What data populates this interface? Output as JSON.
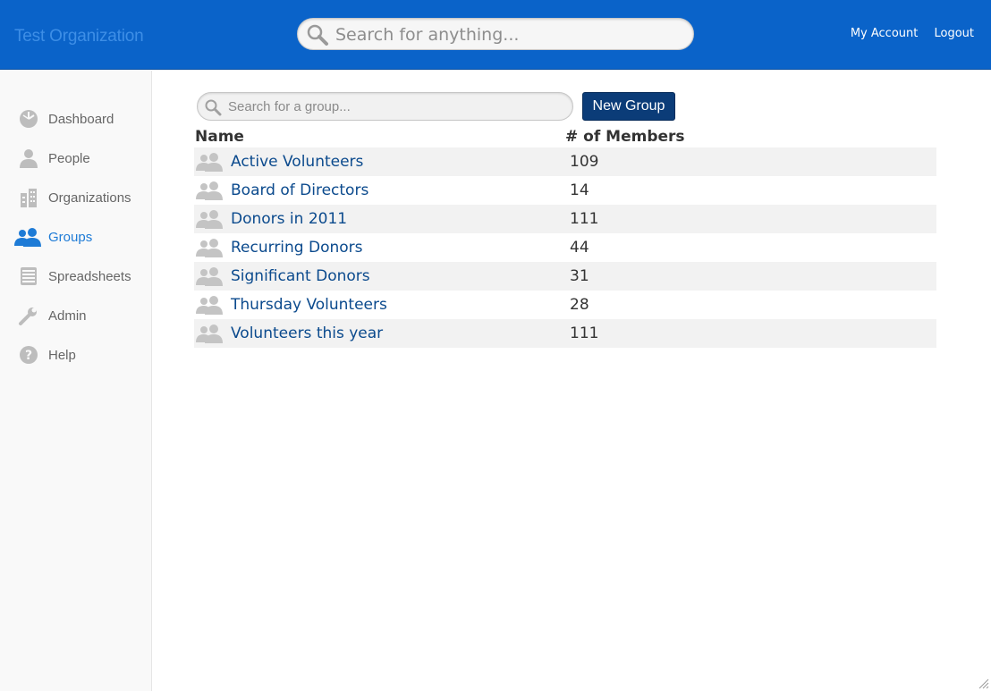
{
  "header": {
    "org_name": "Test Organization",
    "search_placeholder": "Search for anything...",
    "links": {
      "my_account": "My Account",
      "logout": "Logout"
    }
  },
  "sidebar": {
    "items": [
      {
        "label": "Dashboard",
        "icon": "dashboard-icon",
        "active": false
      },
      {
        "label": "People",
        "icon": "person-icon",
        "active": false
      },
      {
        "label": "Organizations",
        "icon": "building-icon",
        "active": false
      },
      {
        "label": "Groups",
        "icon": "group-icon",
        "active": true
      },
      {
        "label": "Spreadsheets",
        "icon": "spreadsheet-icon",
        "active": false
      },
      {
        "label": "Admin",
        "icon": "wrench-icon",
        "active": false
      },
      {
        "label": "Help",
        "icon": "help-icon",
        "active": false
      }
    ]
  },
  "main": {
    "group_search_placeholder": "Search for a group...",
    "new_group_label": "New Group",
    "table": {
      "columns": [
        "Name",
        "# of Members"
      ],
      "rows": [
        {
          "name": "Active Volunteers",
          "members": "109"
        },
        {
          "name": "Board of Directors",
          "members": "14"
        },
        {
          "name": "Donors in 2011",
          "members": "111"
        },
        {
          "name": "Recurring Donors",
          "members": "44"
        },
        {
          "name": "Significant Donors",
          "members": "31"
        },
        {
          "name": "Thursday Volunteers",
          "members": "28"
        },
        {
          "name": "Volunteers this year",
          "members": "111"
        }
      ]
    }
  },
  "colors": {
    "header_bg": "#0a63c9",
    "accent": "#1e7bd6",
    "link": "#0b4a8d",
    "button_bg": "#0b3c78",
    "row_stripe": "#f2f2f2"
  }
}
